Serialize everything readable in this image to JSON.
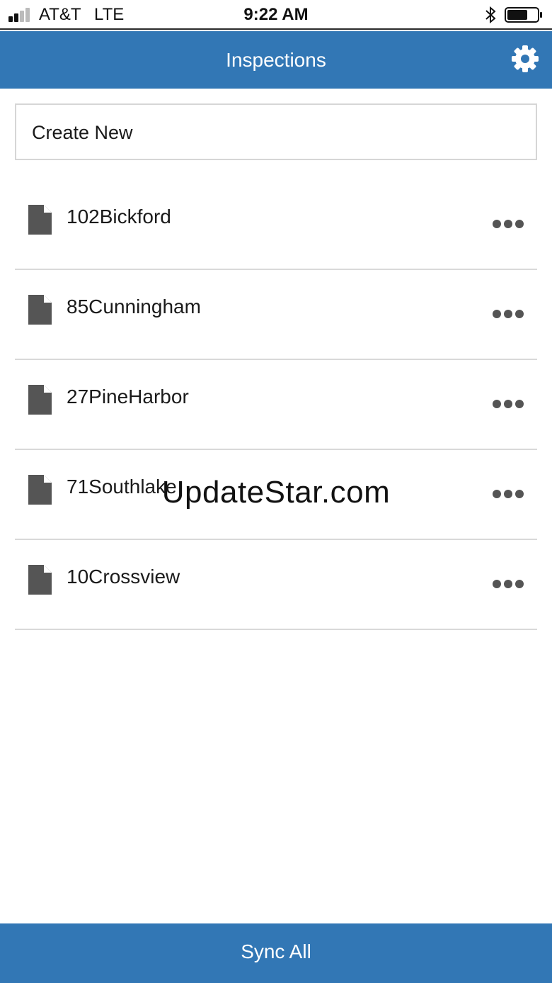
{
  "status_bar": {
    "carrier": "AT&T",
    "network": "LTE",
    "time": "9:22 AM"
  },
  "header": {
    "title": "Inspections",
    "settings_icon": "gear-icon"
  },
  "create_new": {
    "label": "Create New"
  },
  "inspections": [
    {
      "name": "102Bickford"
    },
    {
      "name": "85Cunningham"
    },
    {
      "name": "27PineHarbor"
    },
    {
      "name": "71Southlake"
    },
    {
      "name": "10Crossview"
    }
  ],
  "footer": {
    "sync_label": "Sync All"
  },
  "watermark": "UpdateStar.com",
  "colors": {
    "accent": "#3277b5",
    "icon": "#555555"
  }
}
